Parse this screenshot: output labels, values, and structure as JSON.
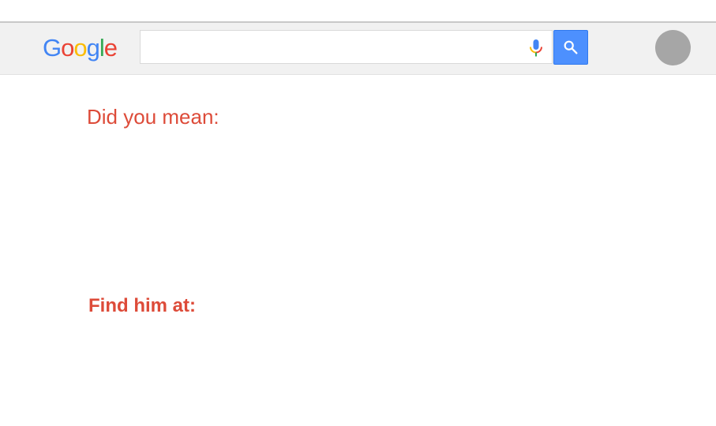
{
  "header": {
    "logo": {
      "letters": [
        {
          "char": "G",
          "color": "#4285f4"
        },
        {
          "char": "o",
          "color": "#ea4335"
        },
        {
          "char": "o",
          "color": "#fbbc05"
        },
        {
          "char": "g",
          "color": "#4285f4"
        },
        {
          "char": "l",
          "color": "#34a853"
        },
        {
          "char": "e",
          "color": "#ea4335"
        }
      ]
    },
    "search": {
      "value": "",
      "placeholder": ""
    },
    "mic_icon": "microphone-icon",
    "search_button_icon": "search-icon",
    "accent_color": "#4d90fe",
    "avatar_color": "#a6a6a6"
  },
  "main": {
    "did_you_mean": "Did you mean:",
    "find_him_at": "Find him at:",
    "heading_color": "#dd4b39"
  }
}
